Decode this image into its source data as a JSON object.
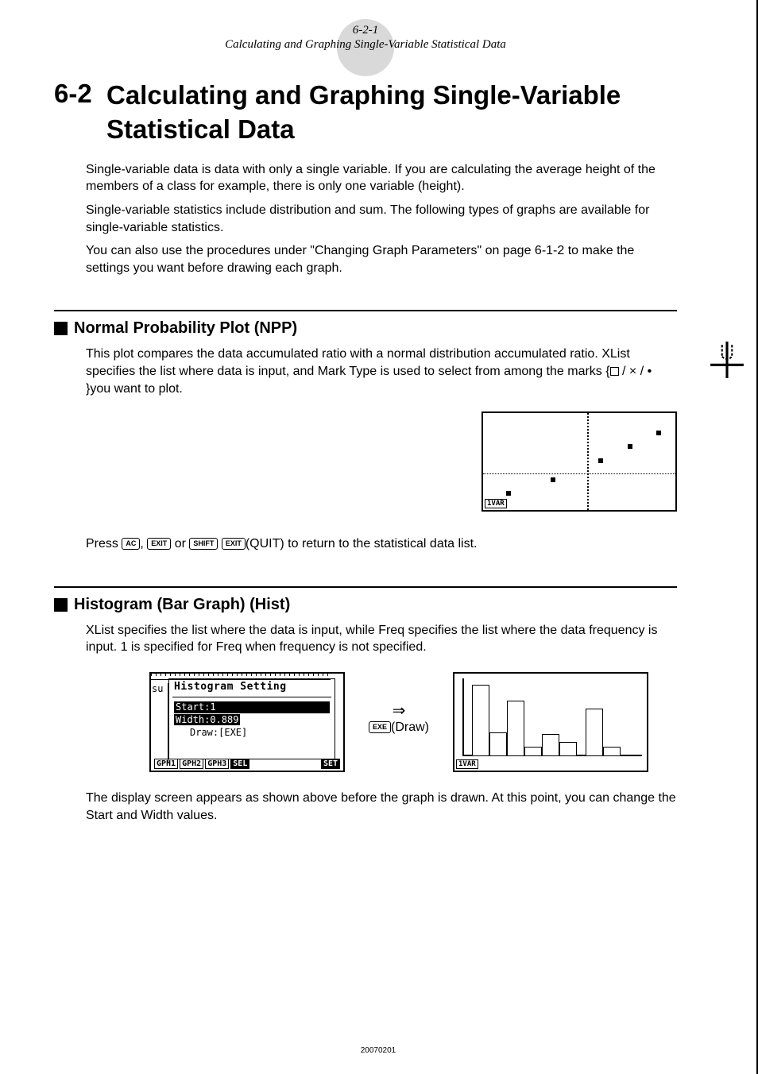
{
  "header": {
    "page_num": "6-2-1",
    "subtitle": "Calculating and Graphing Single-Variable Statistical Data"
  },
  "chapter": {
    "number": "6-2",
    "title": "Calculating and Graphing Single-Variable Statistical Data"
  },
  "intro": {
    "p1": "Single-variable data is data with only a single variable. If you are calculating the average height of the members of a class for example, there is only one variable (height).",
    "p2": "Single-variable statistics include distribution and sum. The following types of graphs are available for single-variable statistics.",
    "p3": "You can also use the procedures under \"Changing Graph Parameters\" on page 6-1-2 to make the settings you want before drawing each graph."
  },
  "npp": {
    "title": "Normal Probability Plot (NPP)",
    "body": "This plot compares the data accumulated ratio with a normal distribution accumulated ratio. XList specifies the list where data is input, and Mark Type is used to select from among the marks {",
    "marks_tail": " / × / • }you want to plot.",
    "softkey": "1VAR",
    "press_prefix": "Press ",
    "press_keys": {
      "ac": "AC",
      "exit": "EXIT",
      "shift": "SHIFT"
    },
    "press_sep1": ", ",
    "press_sep2": " or ",
    "press_quit": "(QUIT)",
    "press_tail": " to return to the statistical data list."
  },
  "hist": {
    "title": "Histogram (Bar Graph) (Hist)",
    "body": "XList specifies the list where the data is input, while Freq specifies the list where the data frequency is input. 1 is specified for Freq when frequency is not specified.",
    "setting_left_fragment": "su",
    "setting_title": "Histogram Setting",
    "setting_line1": "Start:1",
    "setting_line2": "Width:0.889",
    "setting_line3": "Draw:[EXE]",
    "softkeys": {
      "gph1": "GPH1",
      "gph2": "GPH2",
      "gph3": "GPH3",
      "sel": "SEL",
      "set": "SET"
    },
    "arrow": "⇒",
    "draw_key": "EXE",
    "draw_label": "(Draw)",
    "softkey_right": "1VAR",
    "post": "The display screen appears as shown above before the graph is drawn. At this point, you can change the Start and Width values."
  },
  "footer": {
    "code": "20070201"
  }
}
